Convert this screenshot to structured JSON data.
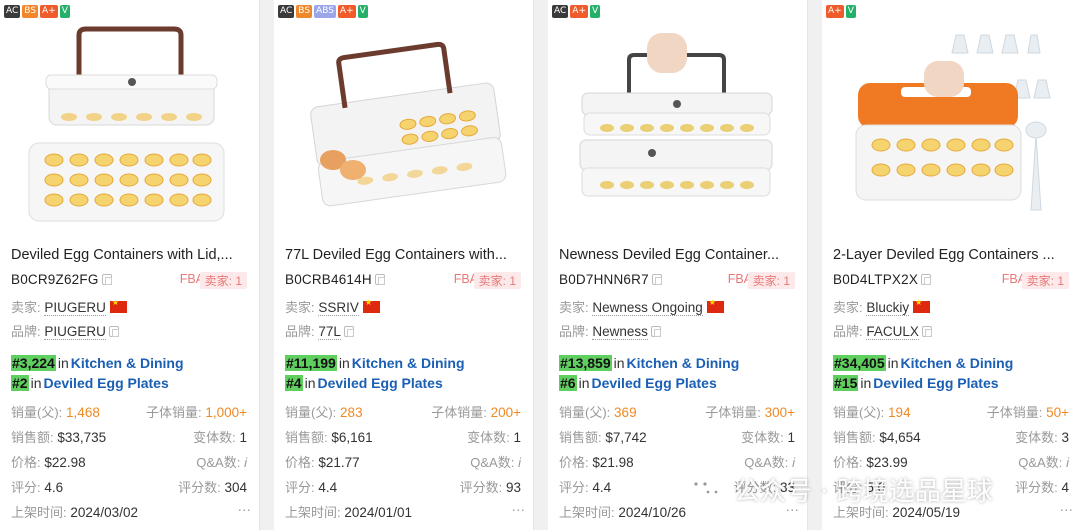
{
  "products": [
    {
      "tags": [
        "AC",
        "BS",
        "A+",
        "V"
      ],
      "title": "Deviled Egg Containers with Lid,...",
      "asin": "B0CR9Z62FG",
      "fba": "FBA",
      "seller_count": "卖家: 1",
      "seller_label": "卖家:",
      "seller": "PIUGERU",
      "brand_label": "品牌:",
      "brand": "PIUGERU",
      "rank1_num": "#3,224",
      "rank1_in": "in",
      "rank1_cat": "Kitchen & Dining",
      "rank2_num": "#2",
      "rank2_in": "in",
      "rank2_cat": "Deviled Egg Plates",
      "sales_label": "销量(父):",
      "sales": "1,468",
      "child_sales_label": "子体销量:",
      "child_sales": "1,000+",
      "revenue_label": "销售额:",
      "revenue": "$33,735",
      "variants_label": "变体数:",
      "variants": "1",
      "price_label": "价格:",
      "price": "$22.98",
      "qa_label": "Q&A数:",
      "qa": "i",
      "rating_label": "评分:",
      "rating": "4.6",
      "reviews_label": "评分数:",
      "reviews": "304",
      "listed_label": "上架时间:",
      "listed": "2024/03/02",
      "more": "···"
    },
    {
      "tags": [
        "AC",
        "BS",
        "ABS",
        "A+",
        "V"
      ],
      "title": "77L Deviled Egg Containers with...",
      "asin": "B0CRB4614H",
      "fba": "FBA",
      "seller_count": "卖家: 1",
      "seller_label": "卖家:",
      "seller": "SSRIV",
      "brand_label": "品牌:",
      "brand": "77L",
      "rank1_num": "#11,199",
      "rank1_in": "in",
      "rank1_cat": "Kitchen & Dining",
      "rank2_num": "#4",
      "rank2_in": "in",
      "rank2_cat": "Deviled Egg Plates",
      "sales_label": "销量(父):",
      "sales": "283",
      "child_sales_label": "子体销量:",
      "child_sales": "200+",
      "revenue_label": "销售额:",
      "revenue": "$6,161",
      "variants_label": "变体数:",
      "variants": "1",
      "price_label": "价格:",
      "price": "$21.77",
      "qa_label": "Q&A数:",
      "qa": "i",
      "rating_label": "评分:",
      "rating": "4.4",
      "reviews_label": "评分数:",
      "reviews": "93",
      "listed_label": "上架时间:",
      "listed": "2024/01/01",
      "more": "···"
    },
    {
      "tags": [
        "AC",
        "A+",
        "V"
      ],
      "title": "Newness Deviled Egg Container...",
      "asin": "B0D7HNN6R7",
      "fba": "FBA",
      "seller_count": "卖家: 1",
      "seller_label": "卖家:",
      "seller": "Newness Ongoing",
      "brand_label": "品牌:",
      "brand": "Newness",
      "rank1_num": "#13,859",
      "rank1_in": "in",
      "rank1_cat": "Kitchen & Dining",
      "rank2_num": "#6",
      "rank2_in": "in",
      "rank2_cat": "Deviled Egg Plates",
      "sales_label": "销量(父):",
      "sales": "369",
      "child_sales_label": "子体销量:",
      "child_sales": "300+",
      "revenue_label": "销售额:",
      "revenue": "$7,742",
      "variants_label": "变体数:",
      "variants": "1",
      "price_label": "价格:",
      "price": "$21.98",
      "qa_label": "Q&A数:",
      "qa": "i",
      "rating_label": "评分:",
      "rating": "4.4",
      "reviews_label": "评分数:",
      "reviews": "33",
      "listed_label": "上架时间:",
      "listed": "2024/10/26",
      "more": "···"
    },
    {
      "tags": [
        "A+",
        "V"
      ],
      "title": "2-Layer Deviled Egg Containers ...",
      "asin": "B0D4LTPX2X",
      "fba": "FBA",
      "seller_count": "卖家: 1",
      "seller_label": "卖家:",
      "seller": "Bluckiy",
      "brand_label": "品牌:",
      "brand": "FACULX",
      "rank1_num": "#34,405",
      "rank1_in": "in",
      "rank1_cat": "Kitchen & Dining",
      "rank2_num": "#15",
      "rank2_in": "in",
      "rank2_cat": "Deviled Egg Plates",
      "sales_label": "销量(父):",
      "sales": "194",
      "child_sales_label": "子体销量:",
      "child_sales": "50+",
      "revenue_label": "销售额:",
      "revenue": "$4,654",
      "variants_label": "变体数:",
      "variants": "3",
      "price_label": "价格:",
      "price": "$23.99",
      "qa_label": "Q&A数:",
      "qa": "i",
      "rating_label": "评分:",
      "rating": "5.0",
      "reviews_label": "评分数:",
      "reviews": "4",
      "listed_label": "上架时间:",
      "listed": "2024/05/19",
      "more": "···"
    }
  ],
  "watermark": "公众号 · 跨境选品星球",
  "colors": {
    "rank_link": "#1a5fb4",
    "rank_highlight": "#5fcf5f",
    "sales_orange": "#f08a24",
    "fba_red": "#e87878",
    "lid_orange": "#f07a24"
  }
}
